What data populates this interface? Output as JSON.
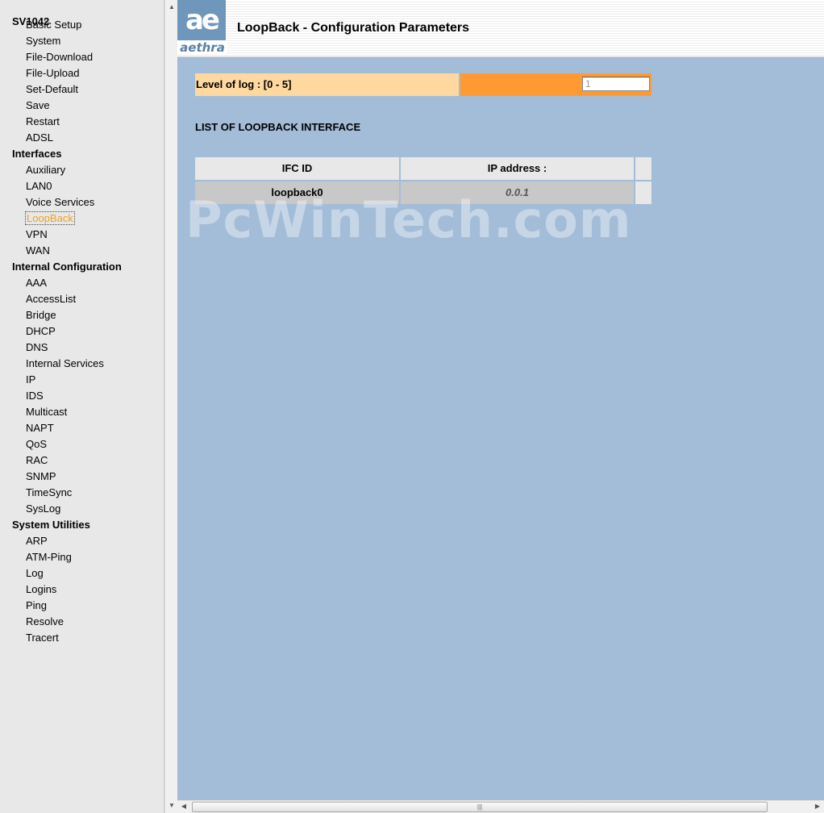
{
  "nav": {
    "title": "SV1042",
    "groups": [
      {
        "label": "",
        "items": [
          "Basic Setup",
          "System",
          "File-Download",
          "File-Upload",
          "Set-Default",
          "Save",
          "Restart",
          "ADSL"
        ]
      },
      {
        "label": "Interfaces",
        "items": [
          "Auxiliary",
          "LAN0",
          "Voice Services",
          "LoopBack",
          "VPN",
          "WAN"
        ]
      },
      {
        "label": "Internal Configuration",
        "items": [
          "AAA",
          "AccessList",
          "Bridge",
          "DHCP",
          "DNS",
          "Internal Services",
          "IP",
          "IDS",
          "Multicast",
          "NAPT",
          "QoS",
          "RAC",
          "SNMP",
          "TimeSync",
          "SysLog"
        ]
      },
      {
        "label": "System Utilities",
        "items": [
          "ARP",
          "ATM-Ping",
          "Log",
          "Logins",
          "Ping",
          "Resolve",
          "Tracert"
        ]
      }
    ],
    "active_item": "LoopBack",
    "active_color": "#f0a020"
  },
  "header": {
    "logo_mark": "ae",
    "brand": "aethra",
    "title": "LoopBack - Configuration Parameters"
  },
  "log_level": {
    "label": "Level of log : [0 - 5]",
    "value": "1",
    "label_color": "#ffd8a0",
    "value_color": "#ff9a33"
  },
  "loopback": {
    "section_title": "LIST OF LOOPBACK INTERFACE",
    "columns": [
      "IFC ID",
      "IP address :"
    ],
    "rows": [
      {
        "ifc_id": "loopback0",
        "ip": "0.0.1"
      }
    ]
  },
  "watermark": "PcWinTech.com",
  "colors": {
    "main_bg": "#a3bdd8",
    "nav_bg": "#e8e8e8"
  }
}
